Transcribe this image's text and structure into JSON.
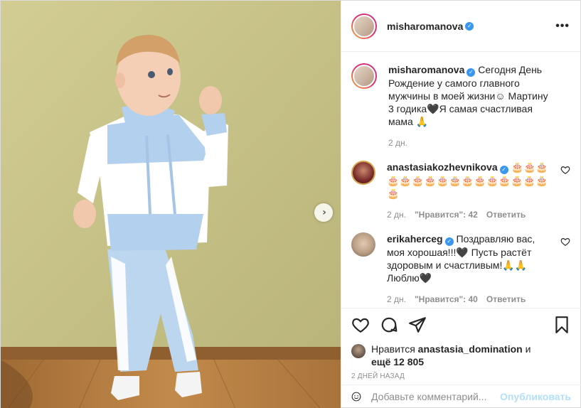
{
  "post": {
    "author": "misharomanova",
    "next_icon": "chevron-right-icon"
  },
  "header": {
    "username": "misharomanova",
    "more_label": "•••"
  },
  "caption": {
    "username": "misharomanova",
    "text": "Сегодня День Рождение у самого главного мужчины в моей жизни☺ Мартину 3 годика🖤Я самая счастливая мама 🙏",
    "time": "2 дн."
  },
  "comments": [
    {
      "username": "anastasiakozhevnikova",
      "text": "🎂🎂🎂🎂🎂🎂🎂🎂🎂🎂🎂🎂🎂🎂🎂🎂🎂",
      "time": "2 дн.",
      "likes": "\"Нравится\": 42",
      "reply": "Ответить"
    },
    {
      "username": "erikaherceg",
      "text": "Поздравляю вас, моя хорошая!!!🖤 Пусть растёт здоровым и счастливым!🙏🙏 Люблю🖤",
      "time": "2 дн.",
      "likes": "\"Нравится\": 40",
      "reply": "Ответить"
    }
  ],
  "likes": {
    "prefix": "Нравится",
    "user": "anastasia_domination",
    "and": "и",
    "others": "ещё 12 805"
  },
  "timestamp": "2 ДНЕЙ НАЗАД",
  "add_comment": {
    "placeholder": "Добавьте комментарий...",
    "publish": "Опубликовать"
  },
  "colors": {
    "verified": "#3897f0",
    "publish": "#b2dffc",
    "muted": "#8e8e8e",
    "wall": "#c9c48a"
  },
  "icons": [
    "heart-icon",
    "comment-icon",
    "share-icon",
    "bookmark-icon",
    "smile-icon",
    "verified-icon"
  ]
}
